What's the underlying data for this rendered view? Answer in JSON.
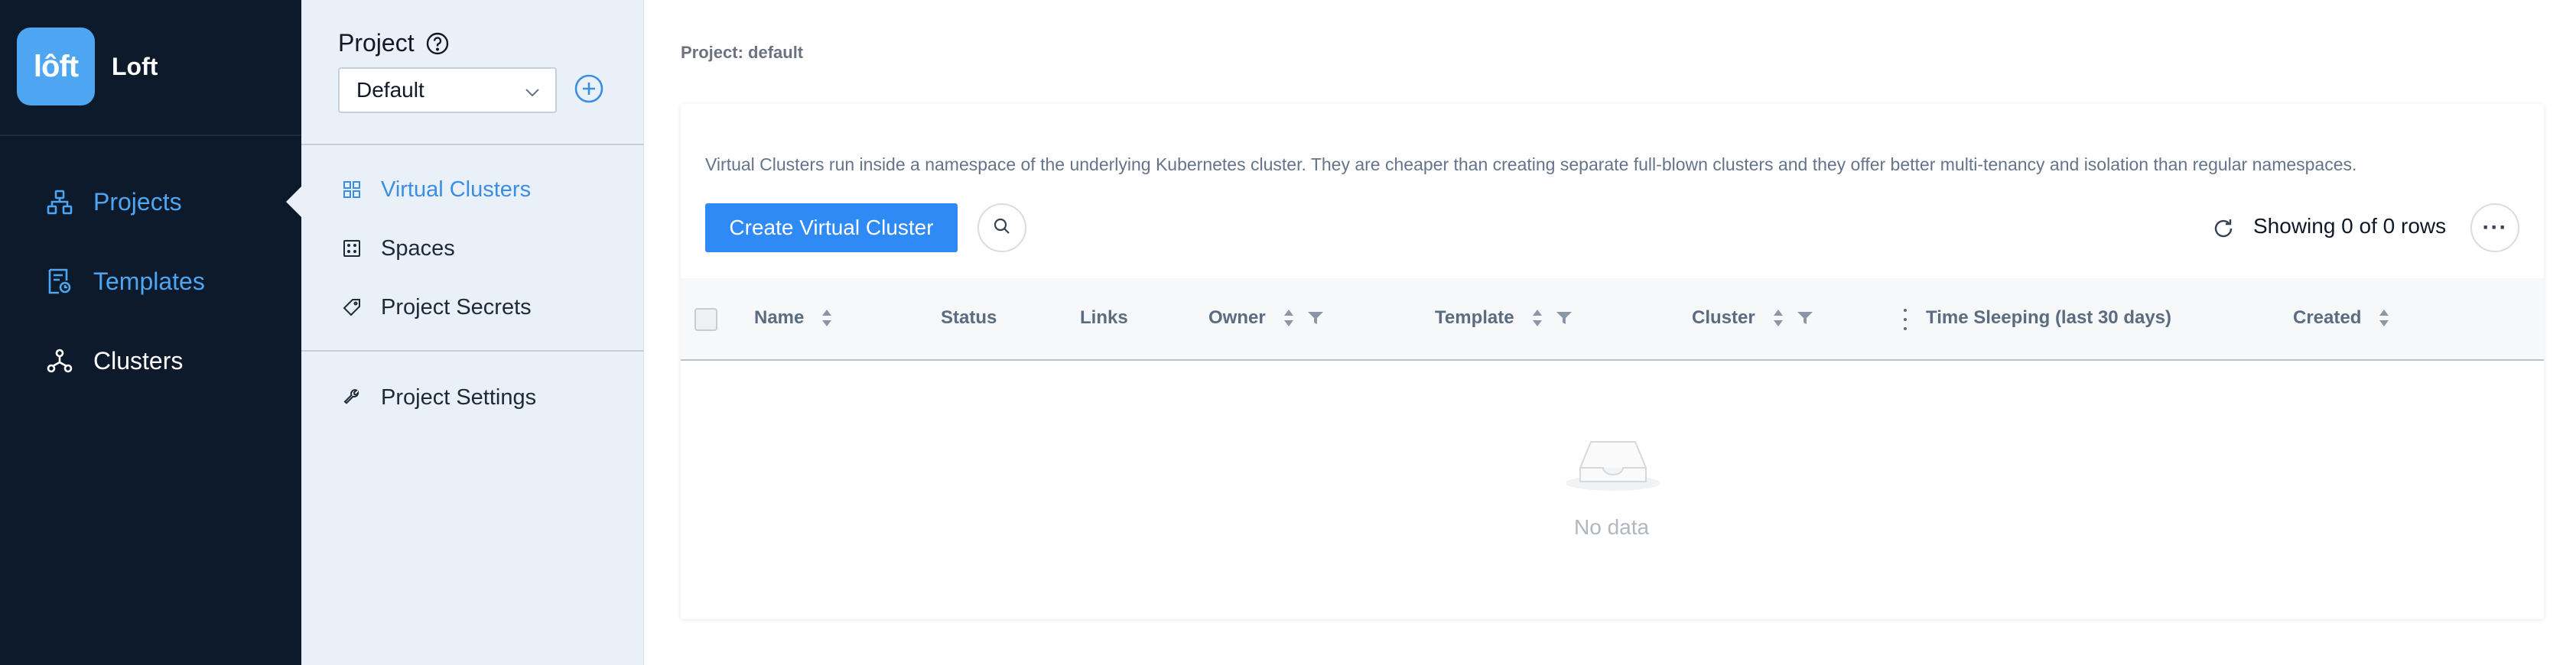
{
  "brand": {
    "logo_text": "lôft",
    "name": "Loft"
  },
  "nav": {
    "items": [
      {
        "label": "Projects",
        "icon": "projects-icon",
        "active": true
      },
      {
        "label": "Templates",
        "icon": "templates-icon",
        "active": false
      },
      {
        "label": "Clusters",
        "icon": "clusters-icon",
        "active": false
      }
    ]
  },
  "subnav": {
    "project_label": "Project",
    "selected_project": "Default",
    "items": [
      {
        "label": "Virtual Clusters",
        "icon": "grid-icon",
        "active": true
      },
      {
        "label": "Spaces",
        "icon": "spaces-icon",
        "active": false
      },
      {
        "label": "Project Secrets",
        "icon": "tag-icon",
        "active": false
      },
      {
        "label": "Project Settings",
        "icon": "wrench-icon",
        "active": false
      }
    ]
  },
  "main": {
    "title": "Project: default",
    "description": "Virtual Clusters run inside a namespace of the underlying Kubernetes cluster. They are cheaper than creating separate full-blown clusters and they offer better multi-tenancy and isolation than regular namespaces.",
    "create_button": "Create Virtual Cluster",
    "showing": "Showing 0 of 0 rows",
    "more_label": "···",
    "columns": [
      {
        "label": "Name",
        "sortable": true,
        "filterable": false
      },
      {
        "label": "Status",
        "sortable": false,
        "filterable": false
      },
      {
        "label": "Links",
        "sortable": false,
        "filterable": false
      },
      {
        "label": "Owner",
        "sortable": true,
        "filterable": true
      },
      {
        "label": "Template",
        "sortable": true,
        "filterable": true
      },
      {
        "label": "Cluster",
        "sortable": true,
        "filterable": true
      },
      {
        "label": "Time Sleeping (last 30 days)",
        "sortable": false,
        "filterable": false
      },
      {
        "label": "Created",
        "sortable": true,
        "filterable": false
      }
    ],
    "empty_text": "No data"
  },
  "colors": {
    "nav_bg": "#0c1a2b",
    "accent": "#4ea6f2",
    "button": "#2f8af5",
    "subnav_bg": "#eaf0f7"
  }
}
